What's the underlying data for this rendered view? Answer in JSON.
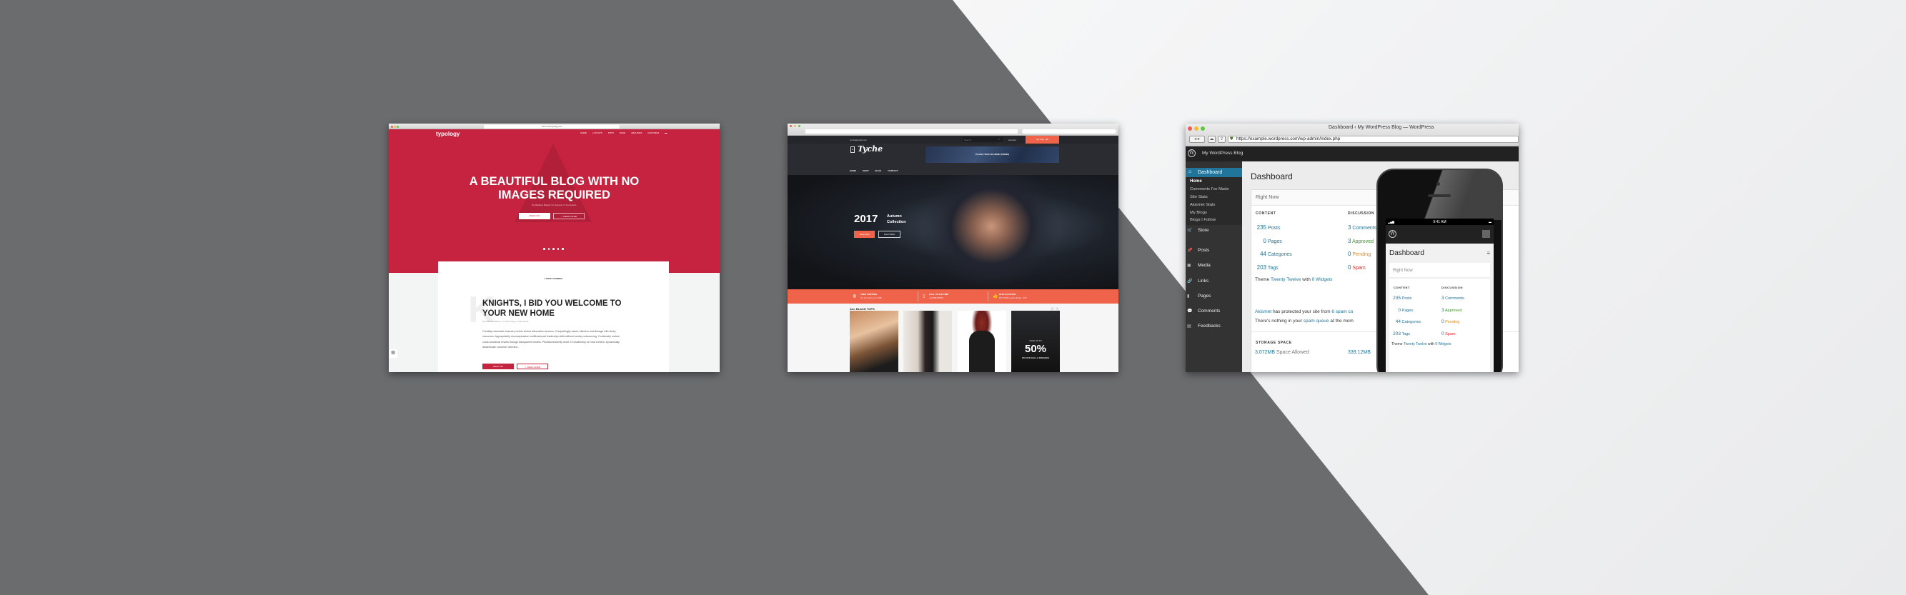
{
  "background": {
    "dark": "#6b6c6e",
    "light": "#f1f2f3"
  },
  "typology": {
    "url": "demo.meks.typology.com",
    "logo": "typology",
    "nav": [
      "HOME",
      "LAYOUTS",
      "POST",
      "PAGE",
      "ARCHIVES",
      "FEATURES"
    ],
    "hero_title": "A BEAUTIFUL BLOG WITH NO IMAGES REQUIRED",
    "hero_meta": "By Matthew Barrett / In Humans / 4 Comments",
    "read_on": "READ ON",
    "read_later": "☆ READ LATER",
    "section_title": "LATEST STORIES",
    "post_title": "KNIGHTS, I BID YOU WELCOME TO YOUR NEW HOME",
    "post_meta": "By Matthew Barrett / In Technology / 3 Min Read",
    "post_excerpt": "Credibly customize visionary niches before alternative services. Compellingly restore effective total linkage with sticky resources. Appropriately reconceptualize multifunctional leadership skills without turnkey outsourcing. Continually restore cross-functional results through transparent models. Phosfluorescently seize 2.0 leadership for viral content. Dynamically disseminate customer directed...",
    "accent": "#c5233f"
  },
  "tyche": {
    "email": "tyche@gmail.com",
    "search_placeholder": "Search...",
    "account": "Account",
    "cart": "My Cart - $0",
    "logo": "Tyche",
    "ad": "PLACE YOUR AD HERE (728X90)",
    "nav": [
      "HOME",
      "SHOP",
      "BLOG",
      "CONTACT"
    ],
    "hero_year": "2017",
    "hero_sub1": "Autumn",
    "hero_sub2": "Collection",
    "shop_now": "Shop Now",
    "learn_more": "Learn More",
    "features": [
      {
        "title": "FREE SHIPPING",
        "sub": "On all orders over 90$",
        "icon": "globe-icon"
      },
      {
        "title": "CALL US ANYTIME",
        "sub": "+04786445953",
        "icon": "phone-icon"
      },
      {
        "title": "OUR LOCATION",
        "sub": "557-6308 Lacinia Road, NYC",
        "icon": "thumbs-up-icon"
      }
    ],
    "section_title": "ALL BLACK TOPS",
    "promo_top": "SAVE UP TO",
    "promo_big": "50%",
    "promo_bottom": "ON OUR GALLA DRESSES",
    "accent": "#ef634a"
  },
  "wordpress": {
    "window_title": "Dashboard ‹ My WordPress Blog — WordPress",
    "url": "https://example.wordpress.com/wp-admin/index.php",
    "site_name": "My WordPress Blog",
    "menu_active": "Dashboard",
    "submenu": [
      "Home",
      "Comments I've Made",
      "Site Stats",
      "Akismet Stats",
      "My Blogs",
      "Blogs I Follow"
    ],
    "menu": [
      {
        "label": "Store",
        "icon": "cart-icon"
      },
      {
        "label": "Posts",
        "icon": "pin-icon"
      },
      {
        "label": "Media",
        "icon": "media-icon"
      },
      {
        "label": "Links",
        "icon": "link-icon"
      },
      {
        "label": "Pages",
        "icon": "pages-icon"
      },
      {
        "label": "Comments",
        "icon": "comment-icon"
      },
      {
        "label": "Feedbacks",
        "icon": "feedback-icon"
      }
    ],
    "page_title": "Dashboard",
    "box_title": "Right Now",
    "content_label": "CONTENT",
    "discussion_label": "DISCUSSION",
    "content": [
      {
        "n": "235",
        "label": "Posts"
      },
      {
        "n": "0",
        "label": "Pages"
      },
      {
        "n": "44",
        "label": "Categories"
      },
      {
        "n": "203",
        "label": "Tags"
      }
    ],
    "discussion": [
      {
        "n": "3",
        "label": "Comments",
        "color": "#21759b"
      },
      {
        "n": "3",
        "label": "Approved",
        "color": "#3a9b22"
      },
      {
        "n": "0",
        "label": "Pending",
        "color": "#e88a12"
      },
      {
        "n": "0",
        "label": "Spam",
        "color": "#e22"
      }
    ],
    "theme_prefix": "Theme",
    "theme_name": "Twenty Twelve",
    "theme_with": "with",
    "widgets": "0 Widgets",
    "akismet_1a": "Akismet",
    "akismet_1b": "has protected your site from",
    "akismet_1c": "6 spam co",
    "akismet_2a": "There's nothing in your",
    "akismet_2b": "spam queue",
    "akismet_2c": "at the mom",
    "storage_label": "STORAGE SPACE",
    "storage_allowed_n": "3,072MB",
    "storage_allowed": "Space Allowed",
    "storage_used": "339.12MB",
    "phone_time": "9:41 AM"
  }
}
